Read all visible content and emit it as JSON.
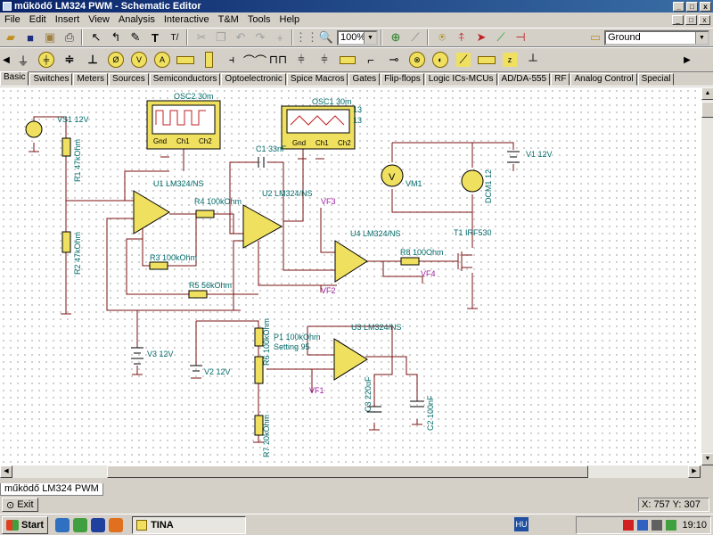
{
  "window": {
    "title": "működő LM324 PWM - Schematic Editor",
    "min": "_",
    "max": "□",
    "close": "x"
  },
  "menu": [
    "File",
    "Edit",
    "Insert",
    "View",
    "Analysis",
    "Interactive",
    "T&M",
    "Tools",
    "Help"
  ],
  "mdi": {
    "min": "_",
    "max": "□",
    "close": "x"
  },
  "toolbar": {
    "zoom_value": "100%",
    "component_value": "Ground"
  },
  "toolbar_icons": [
    "open-icon",
    "save-icon",
    "open-file-icon",
    "print-icon",
    "pointer-icon",
    "wire-icon",
    "pencil-icon",
    "text-icon",
    "label-icon",
    "cut-icon",
    "copy-icon",
    "undo-icon",
    "redo-icon",
    "add-icon",
    "grid-icon",
    "zoom-icon",
    "probe-icon",
    "run-icon",
    "dc-icon",
    "tr-icon",
    "ac-icon",
    "fourier-icon",
    "close-icon"
  ],
  "component_icons": [
    "ground-icon",
    "battery-icon",
    "voltage-source-icon",
    "capacitor-icon",
    "ammeter-icon",
    "voltmeter-icon",
    "generator-icon",
    "resistor-icon",
    "inductor-icon",
    "switch-icon",
    "lamp-icon",
    "diode-icon",
    "transistor-icon",
    "fuse-icon",
    "meter-icon",
    "antenna-icon",
    "relay-icon",
    "transformer-icon",
    "crystal-icon"
  ],
  "tabs": [
    "Basic",
    "Switches",
    "Meters",
    "Sources",
    "Semiconductors",
    "Optoelectronic",
    "Spice Macros",
    "Gates",
    "Flip-flops",
    "Logic ICs-MCUs",
    "AD/DA-555",
    "RF",
    "Analog Control",
    "Special"
  ],
  "active_tab": "Basic",
  "schematic": {
    "labels": {
      "osc2": "OSC2 30m",
      "osc1": "OSC1 30m",
      "gnd": "Gnd",
      "ch1": "Ch1",
      "ch2": "Ch2",
      "vs1": "VS1 12V",
      "r1": "R1 47kOhm",
      "r2": "R2 47kOhm",
      "u1": "U1 LM324/NS",
      "u2": "U2 LM324/NS",
      "u3": "U3 LM324/NS",
      "u4": "U4 LM324/NS",
      "c1": "C1 33nF",
      "r4": "R4 100kOhm",
      "r3": "R3 100kOhm",
      "r5": "R5 56kOhm",
      "vf3": "VF3",
      "vf2": "VF2",
      "vf4": "VF4",
      "vf1": "VF1",
      "v1": "V1 12V",
      "vm1": "VM1",
      "dcm1": "DCM1 12",
      "t1": "T1 IRF530",
      "r8": "R8 100Ohm",
      "v3": "V3 12V",
      "v2": "V2 12V",
      "r6": "R6 100kOhm",
      "p1": "P1 100kOhm",
      "p1_setting": "Setting 95",
      "r7": "R7 20kOhm",
      "c3": "C3 220uF",
      "c2": "C2 100nF",
      "fragment1": "13",
      "fragment2": "13"
    }
  },
  "doc_tab": "működő LM324 PWM",
  "status": {
    "exit": "Exit",
    "coords": "X: 757  Y: 307"
  },
  "taskbar": {
    "start": "Start",
    "app": "TINA",
    "lang": "HU",
    "time": "19:10"
  }
}
